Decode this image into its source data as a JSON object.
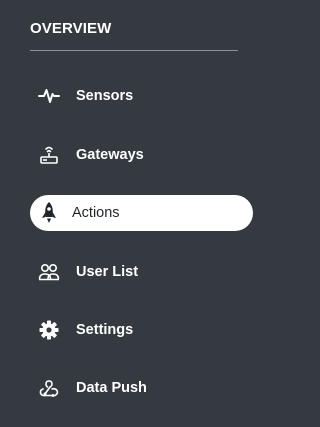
{
  "sidebar": {
    "section_title": "OVERVIEW",
    "items": [
      {
        "label": "Sensors",
        "icon": "pulse-icon",
        "active": false
      },
      {
        "label": "Gateways",
        "icon": "router-icon",
        "active": false
      },
      {
        "label": "Actions",
        "icon": "rocket-icon",
        "active": true
      },
      {
        "label": "User List",
        "icon": "users-icon",
        "active": false
      },
      {
        "label": "Settings",
        "icon": "gear-icon",
        "active": false
      },
      {
        "label": "Data Push",
        "icon": "webhook-icon",
        "active": false
      }
    ]
  },
  "colors": {
    "sidebar_bg": "#353a41",
    "active_bg": "#ffffff",
    "text": "#ffffff",
    "active_text": "#1f242b"
  }
}
